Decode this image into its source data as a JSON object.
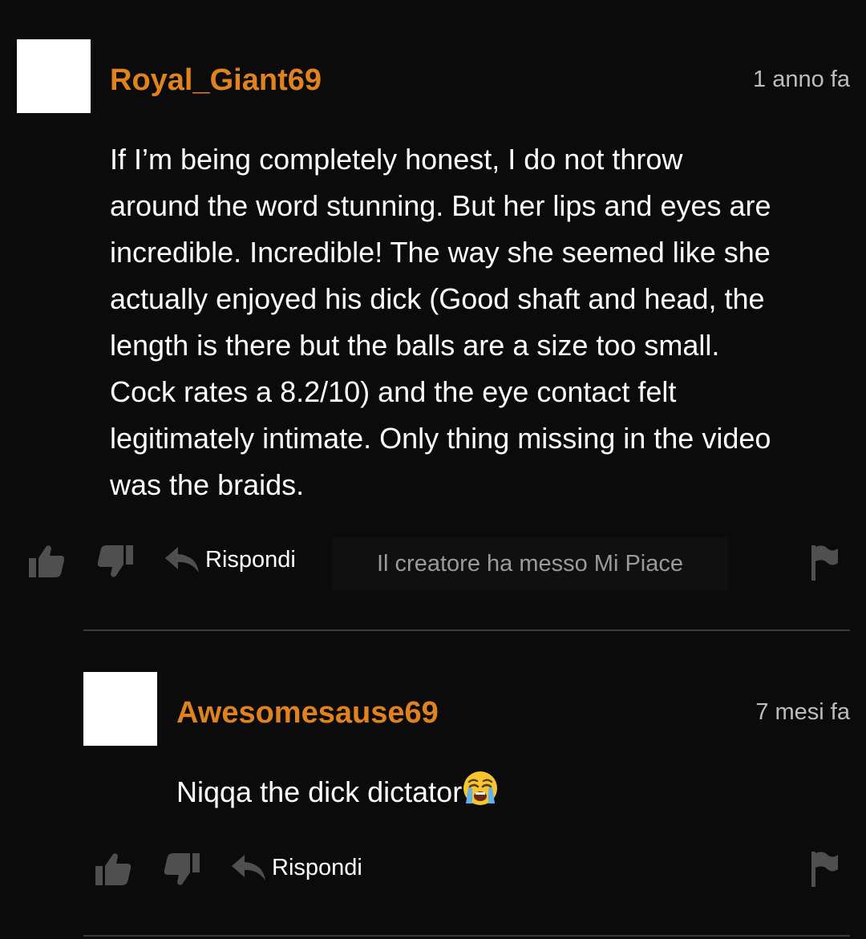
{
  "comments": [
    {
      "username": "Royal_Giant69",
      "timestamp": "1 anno fa",
      "text_lines": [
        "If I’m being completely honest, I do not throw",
        "around the word stunning. But her lips and eyes are",
        "incredible. Incredible! The way she seemed like she",
        "actually enjoyed his dick (Good shaft and head, the",
        "length is there but the balls are a size too small.",
        "Cock rates a 8.2/10) and the eye contact felt",
        "legitimately intimate. Only thing missing in the video",
        "was the braids."
      ],
      "reply_label": "Rispondi",
      "creator_like": "Il creatore ha messo Mi Piace"
    },
    {
      "username": "Awesomesause69",
      "timestamp": "7 mesi fa",
      "text": "Niqqa the dick dictator",
      "emoji": "crying-face-emoji",
      "reply_label": "Rispondi"
    }
  ],
  "icons": {
    "like": "thumbs-up-icon",
    "dislike": "thumbs-down-icon",
    "reply": "reply-arrow-icon",
    "report": "flag-icon"
  },
  "colors": {
    "background": "#0b0b0b",
    "username": "#e0831e",
    "text": "#ffffff",
    "timestamp": "#bdbdbd",
    "icon": "#4f4f4f",
    "muted": "#9a9a9a"
  }
}
